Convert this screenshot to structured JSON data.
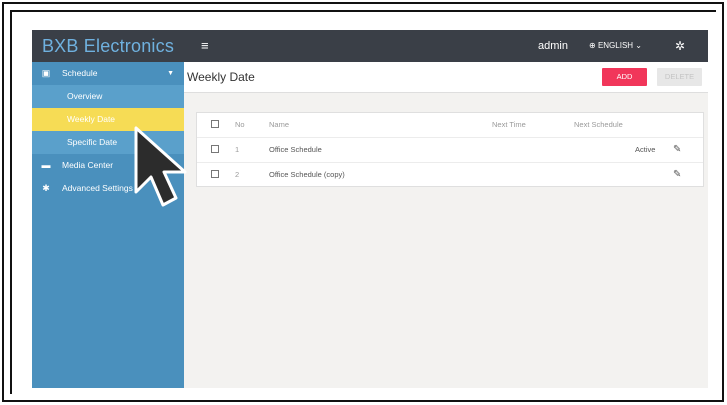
{
  "brand": "BXB Electronics",
  "topbar": {
    "menu_icon": "hamburger-icon",
    "user": "admin",
    "language": "ENGLISH",
    "settings_icon": "gear-icon"
  },
  "sidebar": {
    "schedule": {
      "label": "Schedule",
      "icon": "calendar-icon"
    },
    "sub_items": [
      "Overview",
      "Weekly Date",
      "Specific Date"
    ],
    "active": "Weekly Date",
    "media_center": {
      "label": "Media Center",
      "icon": "folder-icon"
    },
    "advanced_settings": {
      "label": "Advanced Settings",
      "icon": "gear-icon"
    }
  },
  "page": {
    "title": "Weekly Date",
    "add_label": "ADD",
    "delete_label": "DELETE"
  },
  "table": {
    "headers": {
      "no": "No",
      "name": "Name",
      "next_time": "Next Time",
      "next_schedule": "Next Schedule"
    },
    "rows": [
      {
        "no": "1",
        "name": "Office Schedule",
        "next_time": "",
        "next_schedule": "",
        "status": "Active"
      },
      {
        "no": "2",
        "name": "Office Schedule (copy)",
        "next_time": "",
        "next_schedule": "",
        "status": ""
      }
    ]
  },
  "colors": {
    "sidebar": "#4a90bd",
    "active_item": "#f6dc55",
    "topbar": "#3a3f47",
    "add_button": "#f1365a"
  }
}
